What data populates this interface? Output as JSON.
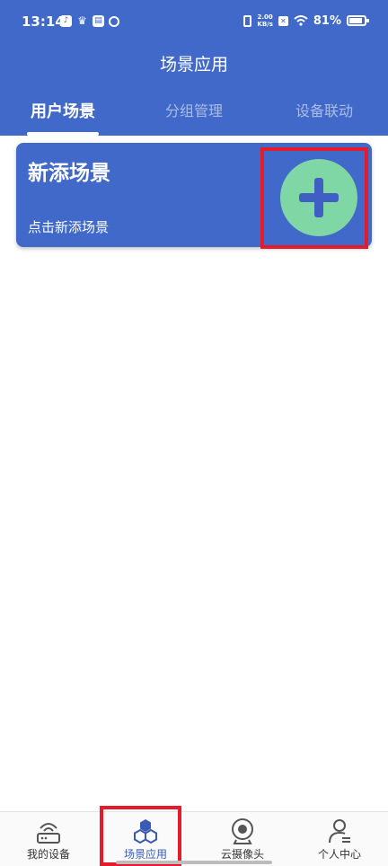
{
  "status_bar": {
    "time": "13:14",
    "net_speed_value": "2.00",
    "net_speed_unit": "KB/s",
    "battery": "81%"
  },
  "app": {
    "title": "场景应用"
  },
  "tabs": [
    {
      "label": "用户场景",
      "active": true
    },
    {
      "label": "分组管理",
      "active": false
    },
    {
      "label": "设备联动",
      "active": false
    }
  ],
  "scene_card": {
    "title": "新添场景",
    "subtitle": "点击新添场景"
  },
  "bottom_nav": [
    {
      "label": "我的设备",
      "icon": "router-icon",
      "active": false
    },
    {
      "label": "场景应用",
      "icon": "hexagons-icon",
      "active": true
    },
    {
      "label": "云摄像头",
      "icon": "camera-icon",
      "active": false
    },
    {
      "label": "个人中心",
      "icon": "person-icon",
      "active": false
    }
  ],
  "colors": {
    "primary": "#4169c9",
    "add_button": "#7fd7a6",
    "highlight": "#e31b2b"
  }
}
